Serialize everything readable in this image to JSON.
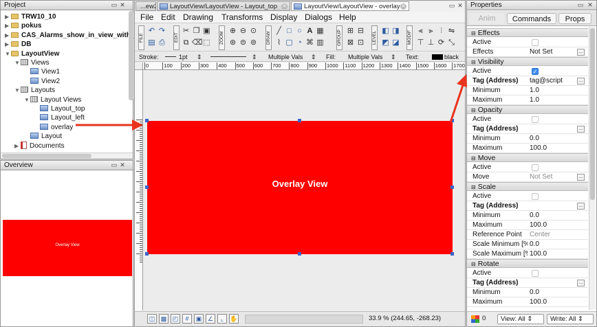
{
  "project": {
    "title": "Project",
    "items": [
      {
        "label": "TRW10_10",
        "level": 0,
        "icon": "folder",
        "bold": true
      },
      {
        "label": "pokus",
        "level": 0,
        "icon": "folder",
        "bold": true
      },
      {
        "label": "CAS_Alarms_show_in_view_with_",
        "level": 0,
        "icon": "folder",
        "bold": true
      },
      {
        "label": "DB",
        "level": 0,
        "icon": "folder",
        "bold": true
      },
      {
        "label": "LayoutView",
        "level": 0,
        "icon": "folder",
        "bold": true
      },
      {
        "label": "Views",
        "level": 1,
        "icon": "group"
      },
      {
        "label": "View1",
        "level": 2,
        "icon": "view"
      },
      {
        "label": "View2",
        "level": 2,
        "icon": "view"
      },
      {
        "label": "Layouts",
        "level": 1,
        "icon": "group"
      },
      {
        "label": "Layout Views",
        "level": 2,
        "icon": "group"
      },
      {
        "label": "Layout_top",
        "level": 3,
        "icon": "view"
      },
      {
        "label": "Layout_left",
        "level": 3,
        "icon": "view"
      },
      {
        "label": "overlay",
        "level": 3,
        "icon": "view"
      },
      {
        "label": "Layout",
        "level": 2,
        "icon": "view"
      },
      {
        "label": "Documents",
        "level": 1,
        "icon": "doc"
      }
    ]
  },
  "overview": {
    "title": "Overview",
    "thumb_label": "Overlay View"
  },
  "editor": {
    "tabs": [
      {
        "label": "...ew2",
        "active": false
      },
      {
        "label": "LayoutView/LayoutView - Layout_top",
        "active": false
      },
      {
        "label": "LayoutView/LayoutView - overlay",
        "active": true
      }
    ],
    "menu": [
      "File",
      "Edit",
      "Drawing",
      "Transforms",
      "Display",
      "Dialogs",
      "Help"
    ],
    "toolbar_groups": [
      "FILE",
      "EDIT",
      "ZOOM",
      "DRAW",
      "GROUP",
      "LEVEL",
      "MODIF"
    ],
    "stroke": {
      "label": "Stroke:",
      "width": "1pt",
      "multi1": "Multiple Vals",
      "fill_label": "Fill:",
      "multi2": "Multiple Vals",
      "text_label": "Text:",
      "text_color": "black"
    },
    "ruler_ticks": [
      "0",
      "100",
      "200",
      "300",
      "400",
      "500",
      "600",
      "700",
      "800",
      "900",
      "1000",
      "1100",
      "1200",
      "1300",
      "1400",
      "1500",
      "1600",
      "1700"
    ],
    "canvas_title": "Overlay View",
    "status_zoom": "33.9 % (244.65, -268.23)"
  },
  "properties": {
    "title": "Properties",
    "tabs": [
      "Anim",
      "Commands",
      "Props"
    ],
    "sections": [
      {
        "title": "Effects",
        "rows": [
          {
            "key": "Active",
            "type": "check",
            "on": false
          },
          {
            "key": "Effects",
            "value": "Not Set",
            "edit": true
          }
        ]
      },
      {
        "title": "Visibility",
        "rows": [
          {
            "key": "Active",
            "type": "check",
            "on": true
          },
          {
            "key": "Tag (Address)",
            "value": "tag@script",
            "bold": true,
            "edit": true
          },
          {
            "key": "Minimum",
            "value": "1.0"
          },
          {
            "key": "Maximum",
            "value": "1.0"
          }
        ]
      },
      {
        "title": "Opacity",
        "rows": [
          {
            "key": "Active",
            "type": "check",
            "on": false
          },
          {
            "key": "Tag (Address)",
            "value": "",
            "bold": true,
            "edit": true
          },
          {
            "key": "Minimum",
            "value": "0.0"
          },
          {
            "key": "Maximum",
            "value": "100.0"
          }
        ]
      },
      {
        "title": "Move",
        "rows": [
          {
            "key": "Active",
            "type": "check",
            "on": false
          },
          {
            "key": "Move",
            "value": "Not Set",
            "grey": true,
            "edit": true
          }
        ]
      },
      {
        "title": "Scale",
        "rows": [
          {
            "key": "Active",
            "type": "check",
            "on": false
          },
          {
            "key": "Tag (Address)",
            "value": "",
            "bold": true,
            "edit": true
          },
          {
            "key": "Minimum",
            "value": "0.0"
          },
          {
            "key": "Maximum",
            "value": "100.0"
          },
          {
            "key": "Reference Point",
            "value": "Center",
            "grey": true
          },
          {
            "key": "Scale Minimum [%]",
            "value": "0.0"
          },
          {
            "key": "Scale Maximum [%]",
            "value": "100.0"
          }
        ]
      },
      {
        "title": "Rotate",
        "rows": [
          {
            "key": "Active",
            "type": "check",
            "on": false
          },
          {
            "key": "Tag (Address)",
            "value": "",
            "bold": true,
            "edit": true
          },
          {
            "key": "Minimum",
            "value": "0.0"
          },
          {
            "key": "Maximum",
            "value": "100.0"
          }
        ]
      }
    ],
    "footer": {
      "count": "0",
      "view": "View: All",
      "write": "Write: All"
    }
  },
  "colors": {
    "canvas_red": "#ff0000",
    "arrow_red": "#e8341c",
    "check_blue": "#3f8ef0"
  }
}
